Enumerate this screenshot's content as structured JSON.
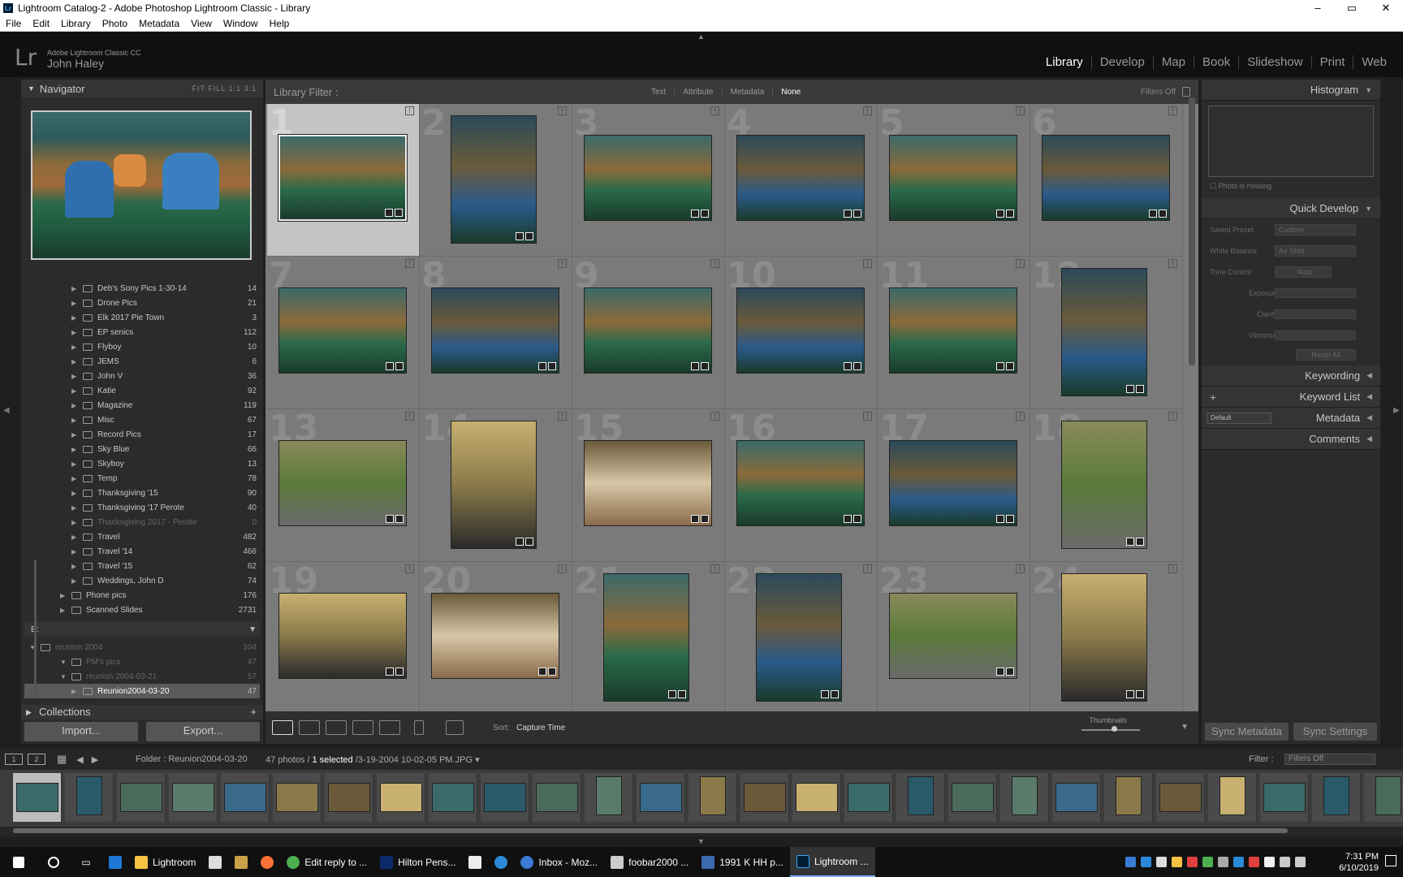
{
  "window": {
    "title": "Lightroom Catalog-2 - Adobe Photoshop Lightroom Classic - Library",
    "lr_badge": "Lr",
    "minimize": "–",
    "maximize": "▭",
    "close": "✕"
  },
  "menu": [
    "File",
    "Edit",
    "Library",
    "Photo",
    "Metadata",
    "View",
    "Window",
    "Help"
  ],
  "identity": {
    "logo": "Lr",
    "product": "Adobe Lightroom Classic CC",
    "user": "John Haley"
  },
  "modules": [
    "Library",
    "Develop",
    "Map",
    "Book",
    "Slideshow",
    "Print",
    "Web"
  ],
  "active_module": "Library",
  "navigator": {
    "title": "Navigator",
    "zoom": "FIT  FILL  1:1  3:1"
  },
  "folders": [
    {
      "label": "Deb's Sony Pics 1-30-14",
      "count": "14",
      "level": 2
    },
    {
      "label": "Drone Pics",
      "count": "21",
      "level": 2
    },
    {
      "label": "Elk 2017 Pie Town",
      "count": "3",
      "level": 2
    },
    {
      "label": "EP senics",
      "count": "112",
      "level": 2
    },
    {
      "label": "Flyboy",
      "count": "10",
      "level": 2
    },
    {
      "label": "JEMS",
      "count": "6",
      "level": 2
    },
    {
      "label": "John V",
      "count": "36",
      "level": 2
    },
    {
      "label": "Katie",
      "count": "92",
      "level": 2
    },
    {
      "label": "Magazine",
      "count": "119",
      "level": 2
    },
    {
      "label": "Misc",
      "count": "67",
      "level": 2
    },
    {
      "label": "Record Pics",
      "count": "17",
      "level": 2
    },
    {
      "label": "Sky Blue",
      "count": "66",
      "level": 2
    },
    {
      "label": "Skyboy",
      "count": "13",
      "level": 2
    },
    {
      "label": "Temp",
      "count": "78",
      "level": 2
    },
    {
      "label": "Thanksgiving '15",
      "count": "90",
      "level": 2
    },
    {
      "label": "Thanksgiving '17 Perote",
      "count": "40",
      "level": 2
    },
    {
      "label": "Thanksgiving 2017 - Perote",
      "count": "0",
      "level": 2,
      "dim": true
    },
    {
      "label": "Travel",
      "count": "482",
      "level": 2
    },
    {
      "label": "Travel '14",
      "count": "466",
      "level": 2
    },
    {
      "label": "Travel '15",
      "count": "62",
      "level": 2
    },
    {
      "label": "Weddings, John D",
      "count": "74",
      "level": 2
    },
    {
      "label": "Phone pics",
      "count": "176",
      "level": 1
    },
    {
      "label": "Scanned Slides",
      "count": "2731",
      "level": 1
    },
    {
      "label": "E:",
      "count": "",
      "level": 0,
      "volume": true
    },
    {
      "label": "reunion 2004",
      "count": "104",
      "level": 0,
      "dim": true
    },
    {
      "label": "PM's pics",
      "count": "47",
      "level": 1,
      "dim": true
    },
    {
      "label": "reunion 2004-03-21",
      "count": "57",
      "level": 1,
      "dim": true
    },
    {
      "label": "Reunion2004-03-20",
      "count": "47",
      "level": 2,
      "sel": true
    }
  ],
  "collections": "Collections",
  "import_label": "Import...",
  "export_label": "Export...",
  "filter": {
    "label": "Library Filter :",
    "options": [
      "Text",
      "Attribute",
      "Metadata",
      "None"
    ],
    "selected": "None",
    "status": "Filters Off"
  },
  "grid": {
    "numbers": [
      "1",
      "2",
      "3",
      "4",
      "5",
      "6",
      "7",
      "8",
      "9",
      "10",
      "11",
      "12",
      "13",
      "14",
      "15",
      "16",
      "17",
      "18",
      "19",
      "20",
      "21",
      "22",
      "23",
      "24"
    ],
    "portrait": [
      2,
      12,
      14,
      18,
      21,
      22,
      24
    ],
    "selected": 1
  },
  "toolbar": {
    "sort_label": "Sort:",
    "sort_value": "Capture Time",
    "thumbnails": "Thumbnails"
  },
  "right": {
    "histogram": "Histogram",
    "photo_missing": "Photo is missing",
    "quick_develop": "Quick Develop",
    "saved_preset": "Saved Preset",
    "saved_preset_value": "Custom",
    "white_balance": "White Balance",
    "white_balance_value": "As Shot",
    "tone_control": "Tone Control",
    "auto": "Auto",
    "exposure": "Exposure",
    "clarity": "Clarity",
    "vibrance": "Vibrance",
    "reset_all": "Reset All",
    "keywording": "Keywording",
    "keyword_list": "Keyword List",
    "metadata": "Metadata",
    "metadata_preset": "Default",
    "comments": "Comments",
    "sync_metadata": "Sync Metadata",
    "sync_settings": "Sync Settings"
  },
  "filmstrip": {
    "screen1": "1",
    "screen2": "2",
    "path": "Folder : Reunion2004-03-20",
    "count_pre": "47 photos /",
    "selected": "1 selected",
    "file": "/3-19-2004 10-02-05 PM.JPG",
    "filter_label": "Filter :",
    "filter_value": "Filters Off"
  },
  "taskbar": {
    "items": [
      "Lightroom",
      "Edit reply to ...",
      "Hilton Pens...",
      "Inbox - Moz...",
      "foobar2000 ...",
      "1991 K HH p...",
      "Lightroom ..."
    ],
    "time": "7:31 PM",
    "date": "6/10/2019"
  }
}
